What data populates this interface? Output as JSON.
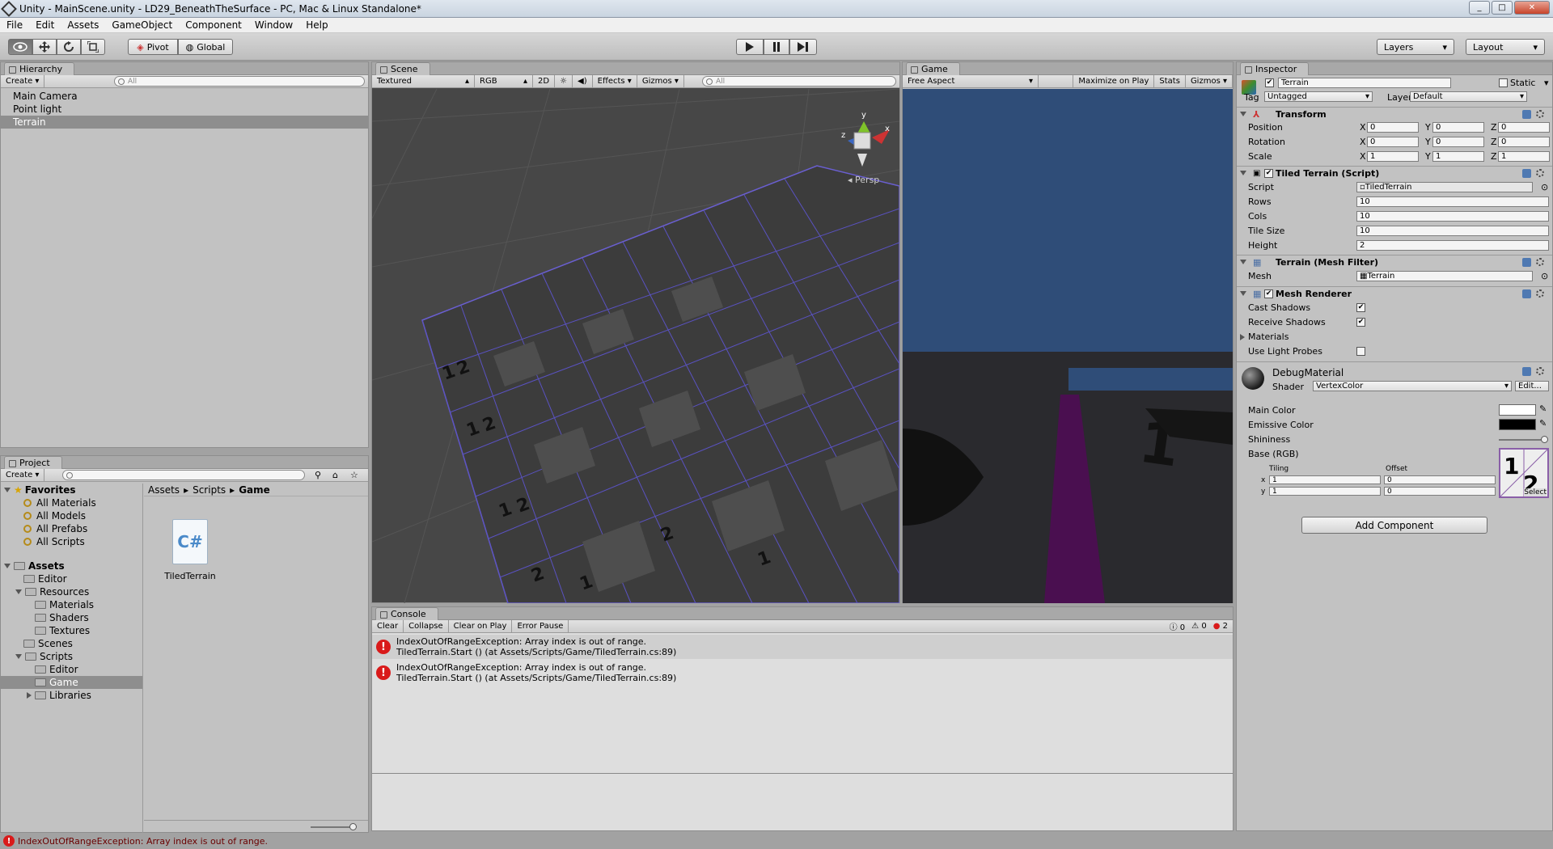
{
  "window": {
    "title": "Unity - MainScene.unity - LD29_BeneathTheSurface - PC, Mac & Linux Standalone*"
  },
  "menu": [
    "File",
    "Edit",
    "Assets",
    "GameObject",
    "Component",
    "Window",
    "Help"
  ],
  "toolbar": {
    "pivot": "Pivot",
    "global": "Global",
    "layers": "Layers",
    "layout": "Layout"
  },
  "hierarchy": {
    "tab": "Hierarchy",
    "create": "Create",
    "search_placeholder": "All",
    "items": [
      "Main Camera",
      "Point light",
      "Terrain"
    ],
    "selected": "Terrain"
  },
  "scene": {
    "tab": "Scene",
    "render_mode": "Textured",
    "color_mode": "RGB",
    "mode2d": "2D",
    "effects": "Effects",
    "gizmos": "Gizmos",
    "search_placeholder": "All",
    "persp": "Persp",
    "axis_x": "x",
    "axis_y": "y",
    "axis_z": "z"
  },
  "game": {
    "tab": "Game",
    "aspect": "Free Aspect",
    "maximize": "Maximize on Play",
    "stats": "Stats",
    "gizmos": "Gizmos"
  },
  "inspector": {
    "tab": "Inspector",
    "object_name": "Terrain",
    "static": "Static",
    "tag_label": "Tag",
    "tag": "Untagged",
    "layer_label": "Layer",
    "layer": "Default",
    "transform": {
      "title": "Transform",
      "position": {
        "label": "Position",
        "x": "0",
        "y": "0",
        "z": "0"
      },
      "rotation": {
        "label": "Rotation",
        "x": "0",
        "y": "0",
        "z": "0"
      },
      "scale": {
        "label": "Scale",
        "x": "1",
        "y": "1",
        "z": "1"
      }
    },
    "tiled_terrain": {
      "title": "Tiled Terrain (Script)",
      "script_label": "Script",
      "script": "TiledTerrain",
      "rows_label": "Rows",
      "rows": "10",
      "cols_label": "Cols",
      "cols": "10",
      "tile_size_label": "Tile Size",
      "tile_size": "10",
      "height_label": "Height",
      "height": "2"
    },
    "mesh_filter": {
      "title": "Terrain (Mesh Filter)",
      "mesh_label": "Mesh",
      "mesh": "Terrain"
    },
    "mesh_renderer": {
      "title": "Mesh Renderer",
      "cast_shadows": "Cast Shadows",
      "receive_shadows": "Receive Shadows",
      "materials": "Materials",
      "use_light_probes": "Use Light Probes"
    },
    "material": {
      "name": "DebugMaterial",
      "shader_label": "Shader",
      "shader": "VertexColor",
      "edit": "Edit...",
      "main_color": "Main Color",
      "emissive_color": "Emissive Color",
      "shininess": "Shininess",
      "base": "Base (RGB)",
      "tiling": "Tiling",
      "offset": "Offset",
      "tiling_x": "1",
      "tiling_y": "1",
      "offset_x": "0",
      "offset_y": "0",
      "select": "Select",
      "main_color_hex": "#ffffff",
      "emissive_color_hex": "#000000"
    },
    "add_component": "Add Component"
  },
  "project": {
    "tab": "Project",
    "create": "Create",
    "favorites": "Favorites",
    "fav_items": [
      "All Materials",
      "All Models",
      "All Prefabs",
      "All Scripts"
    ],
    "assets": "Assets",
    "tree": [
      "Editor",
      "Resources",
      "Materials",
      "Shaders",
      "Textures",
      "Scenes",
      "Scripts",
      "Editor",
      "Game",
      "Libraries"
    ],
    "breadcrumb": [
      "Assets",
      "Scripts",
      "Game"
    ],
    "file": "TiledTerrain",
    "file_icon": "C#"
  },
  "console": {
    "tab": "Console",
    "clear": "Clear",
    "collapse": "Collapse",
    "clear_on_play": "Clear on Play",
    "error_pause": "Error Pause",
    "info_count": "0",
    "warn_count": "0",
    "error_count": "2",
    "entries": [
      {
        "line1": "IndexOutOfRangeException: Array index is out of range.",
        "line2": "TiledTerrain.Start () (at Assets/Scripts/Game/TiledTerrain.cs:89)"
      },
      {
        "line1": "IndexOutOfRangeException: Array index is out of range.",
        "line2": "TiledTerrain.Start () (at Assets/Scripts/Game/TiledTerrain.cs:89)"
      }
    ]
  },
  "statusbar": {
    "message": "IndexOutOfRangeException: Array index is out of range."
  },
  "colors": {
    "scene_bg": "#474747",
    "sky": "#2f4d78",
    "error": "#d91a1a"
  }
}
